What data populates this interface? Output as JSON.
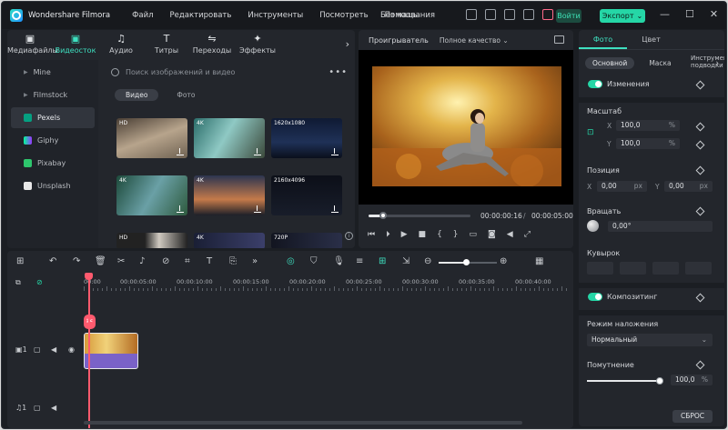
{
  "titlebar": {
    "app_name": "Wondershare Filmora",
    "menu": [
      "Файл",
      "Редактировать",
      "Инструменты",
      "Посмотреть",
      "Помощь"
    ],
    "project_title": "Без названия",
    "login_label": "Войти",
    "export_label": "Экспорт"
  },
  "media": {
    "tabs": [
      {
        "label": "Медиафайлы",
        "icon": "media-icon"
      },
      {
        "label": "Видеосток",
        "icon": "stock-video-icon"
      },
      {
        "label": "Аудио",
        "icon": "music-icon"
      },
      {
        "label": "Титры",
        "icon": "text-icon"
      },
      {
        "label": "Переходы",
        "icon": "transition-icon"
      },
      {
        "label": "Эффекты",
        "icon": "sparkle-icon"
      }
    ],
    "sources": [
      {
        "label": "Mine",
        "kind": "folder"
      },
      {
        "label": "Filmstock",
        "kind": "folder"
      },
      {
        "label": "Pexels",
        "kind": "pexels"
      },
      {
        "label": "Giphy",
        "kind": "giphy"
      },
      {
        "label": "Pixabay",
        "kind": "pixabay"
      },
      {
        "label": "Unsplash",
        "kind": "unsplash"
      }
    ],
    "search_placeholder": "Поиск изображений и видео",
    "filters": [
      "Видео",
      "Фото"
    ],
    "thumbs": [
      {
        "quality": "HD"
      },
      {
        "quality": "4K"
      },
      {
        "quality": "1620x1080"
      },
      {
        "quality": "4K"
      },
      {
        "quality": "4K"
      },
      {
        "quality": "2160x4096"
      },
      {
        "quality": "HD"
      },
      {
        "quality": "4K"
      },
      {
        "quality": "720P"
      }
    ]
  },
  "player": {
    "label": "Проигрыватель",
    "quality": "Полное качество",
    "current_time": "00:00:00:16",
    "total_time": "00:00:05:00",
    "progress": 0.14
  },
  "properties": {
    "tabs": [
      "Фото",
      "Цвет"
    ],
    "subtabs": [
      "Основной",
      "Маска",
      "Инструмент подводки"
    ],
    "transform_label": "Изменения",
    "scale_label": "Масштаб",
    "scale_x": "100,0",
    "scale_y": "100,0",
    "position_label": "Позиция",
    "pos_x": "0,00",
    "pos_y": "0,00",
    "rotate_label": "Вращать",
    "rotate_value": "0,00°",
    "flip_label": "Кувырок",
    "composite_label": "Композитинг",
    "blend_label": "Режим наложения",
    "blend_value": "Нормальный",
    "opacity_label": "Помутнение",
    "opacity_value": "100,0",
    "reset_label": "СБРОС",
    "units": {
      "percent": "%",
      "px": "px"
    },
    "axis": {
      "x": "X",
      "y": "Y"
    }
  },
  "timeline": {
    "ruler": [
      "00:00",
      "00:00:05:00",
      "00:00:10:00",
      "00:00:15:00",
      "00:00:20:00",
      "00:00:25:00",
      "00:00:30:00",
      "00:00:35:00",
      "00:00:40:00"
    ],
    "video_track": "1",
    "audio_track": "1",
    "zoom_level": 0.47
  },
  "colors": {
    "accent": "#25d6a6",
    "playhead": "#ff5a6e",
    "clip": "#7a62c8"
  }
}
